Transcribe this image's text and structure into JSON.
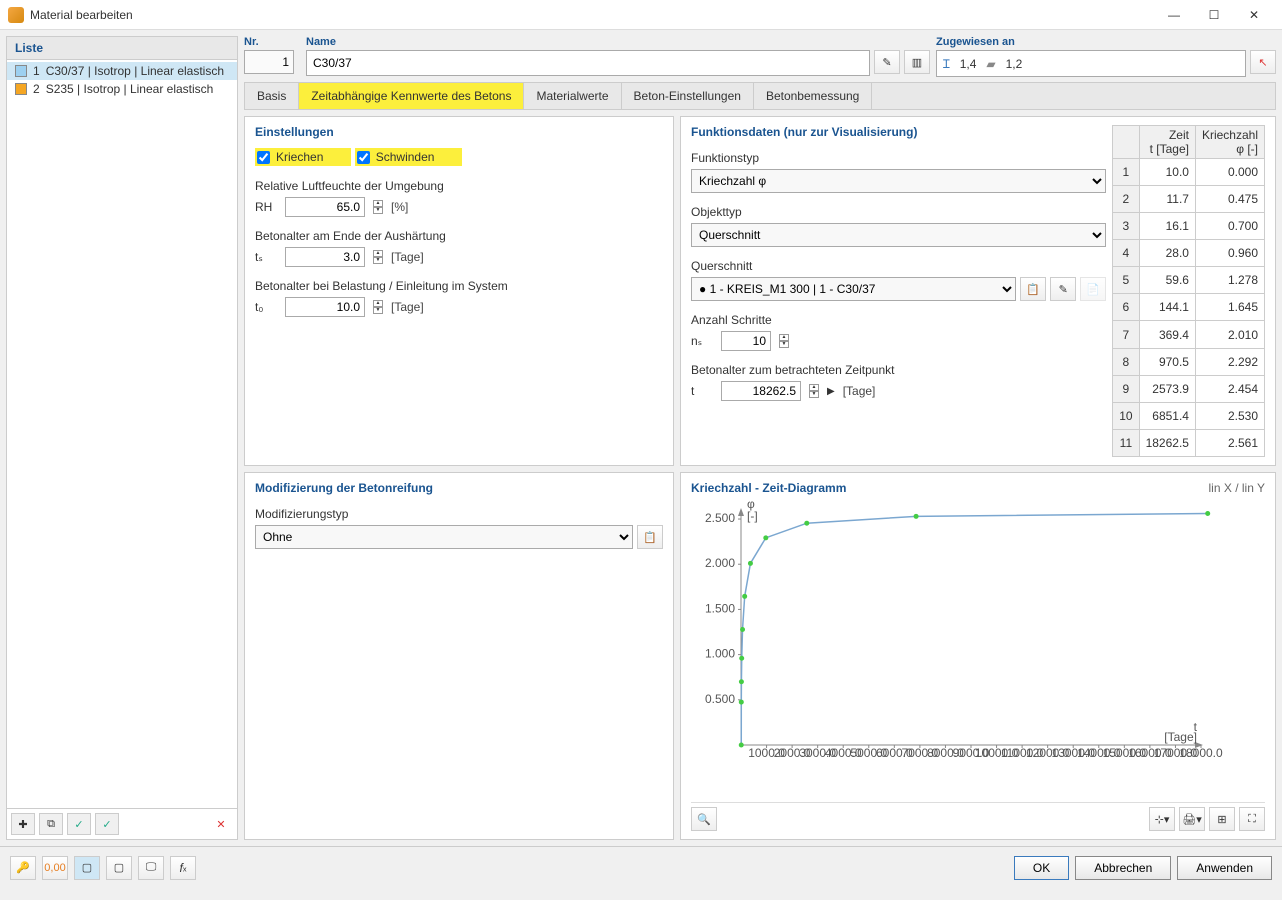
{
  "window": {
    "title": "Material bearbeiten"
  },
  "list": {
    "header": "Liste",
    "items": [
      {
        "num": "1",
        "label": "C30/37 | Isotrop | Linear elastisch"
      },
      {
        "num": "2",
        "label": "S235 | Isotrop | Linear elastisch"
      }
    ]
  },
  "top": {
    "nr_label": "Nr.",
    "nr_value": "1",
    "name_label": "Name",
    "name_value": "C30/37",
    "assigned_label": "Zugewiesen an",
    "assigned_1": "1,4",
    "assigned_2": "1,2"
  },
  "tabs": {
    "t1": "Basis",
    "t2": "Zeitabhängige Kennwerte des Betons",
    "t3": "Materialwerte",
    "t4": "Beton-Einstellungen",
    "t5": "Betonbemessung"
  },
  "settings": {
    "title": "Einstellungen",
    "creep": "Kriechen",
    "shrink": "Schwinden",
    "rh_label": "Relative Luftfeuchte der Umgebung",
    "rh_sym": "RH",
    "rh_val": "65.0",
    "rh_unit": "[%]",
    "ts_label": "Betonalter am Ende der Aushärtung",
    "ts_sym": "tₛ",
    "ts_val": "3.0",
    "ts_unit": "[Tage]",
    "t0_label": "Betonalter bei Belastung / Einleitung im System",
    "t0_sym": "t₀",
    "t0_val": "10.0",
    "t0_unit": "[Tage]"
  },
  "func": {
    "title": "Funktionsdaten (nur zur Visualisierung)",
    "ftype_label": "Funktionstyp",
    "ftype_val": "Kriechzahl φ",
    "otype_label": "Objekttyp",
    "otype_val": "Querschnitt",
    "qs_label": "Querschnitt",
    "qs_val": "1 - KREIS_M1 300 | 1 - C30/37",
    "steps_label": "Anzahl Schritte",
    "steps_sym": "nₛ",
    "steps_val": "10",
    "age_label": "Betonalter zum betrachteten Zeitpunkt",
    "age_sym": "t",
    "age_val": "18262.5",
    "age_unit": "[Tage]"
  },
  "table": {
    "h_time": "Zeit",
    "h_time_u": "t [Tage]",
    "h_creep": "Kriechzahl",
    "h_creep_u": "φ [-]",
    "rows": [
      [
        "1",
        "10.0",
        "0.000"
      ],
      [
        "2",
        "11.7",
        "0.475"
      ],
      [
        "3",
        "16.1",
        "0.700"
      ],
      [
        "4",
        "28.0",
        "0.960"
      ],
      [
        "5",
        "59.6",
        "1.278"
      ],
      [
        "6",
        "144.1",
        "1.645"
      ],
      [
        "7",
        "369.4",
        "2.010"
      ],
      [
        "8",
        "970.5",
        "2.292"
      ],
      [
        "9",
        "2573.9",
        "2.454"
      ],
      [
        "10",
        "6851.4",
        "2.530"
      ],
      [
        "11",
        "18262.5",
        "2.561"
      ]
    ]
  },
  "modif": {
    "title": "Modifizierung der Betonreifung",
    "type_label": "Modifizierungstyp",
    "type_val": "Ohne"
  },
  "chart": {
    "title": "Kriechzahl - Zeit-Diagramm",
    "axes_mode": "lin X / lin Y",
    "ylabel1": "φ",
    "ylabel2": "[-]",
    "xlabel1": "t",
    "xlabel2": "[Tage]"
  },
  "buttons": {
    "ok": "OK",
    "cancel": "Abbrechen",
    "apply": "Anwenden"
  },
  "chart_data": {
    "type": "line",
    "title": "Kriechzahl - Zeit-Diagramm",
    "xlabel": "t [Tage]",
    "ylabel": "φ [-]",
    "x": [
      10.0,
      11.7,
      16.1,
      28.0,
      59.6,
      144.1,
      369.4,
      970.5,
      2573.9,
      6851.4,
      18262.5
    ],
    "y": [
      0.0,
      0.475,
      0.7,
      0.96,
      1.278,
      1.645,
      2.01,
      2.292,
      2.454,
      2.53,
      2.561
    ],
    "xlim": [
      0,
      18000
    ],
    "ylim": [
      0,
      2.6
    ],
    "x_ticks": [
      1000,
      2000,
      3000,
      4000,
      5000,
      6000,
      7000,
      8000,
      9000,
      10000,
      11000,
      12000,
      13000,
      14000,
      15000,
      16000,
      17000,
      18000
    ],
    "y_ticks": [
      0.5,
      1.0,
      1.5,
      2.0,
      2.5
    ]
  }
}
